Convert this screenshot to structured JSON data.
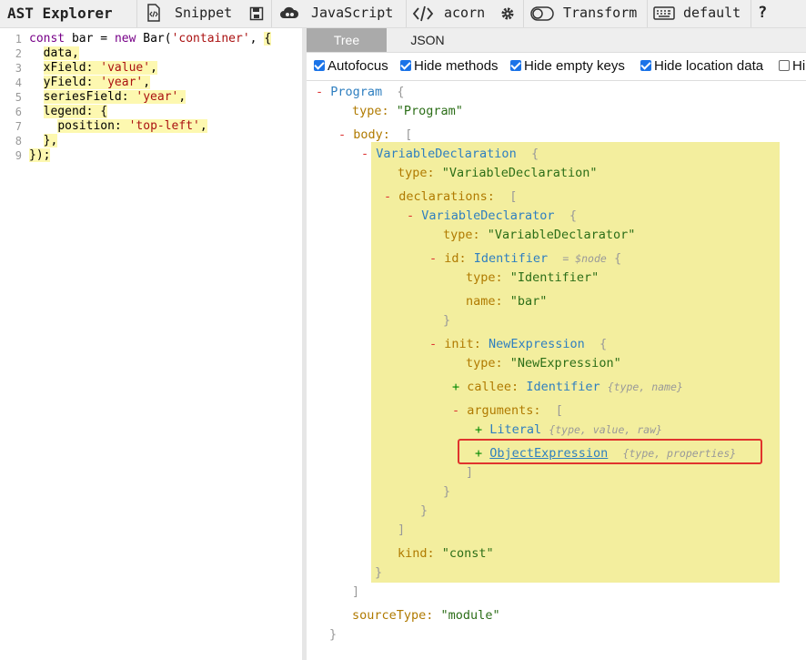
{
  "toolbar": {
    "title": "AST Explorer",
    "snippet_label": "Snippet",
    "language_label": "JavaScript",
    "parser_label": "acorn",
    "transform_label": "Transform",
    "keymap_label": "default",
    "help_label": "?"
  },
  "editor": {
    "lines": [
      {
        "n": "1",
        "text": "const bar = new Bar('container', {"
      },
      {
        "n": "2",
        "text": "  data,"
      },
      {
        "n": "3",
        "text": "  xField: 'value',"
      },
      {
        "n": "4",
        "text": "  yField: 'year',"
      },
      {
        "n": "5",
        "text": "  seriesField: 'year',"
      },
      {
        "n": "6",
        "text": "  legend: {"
      },
      {
        "n": "7",
        "text": "    position: 'top-left',"
      },
      {
        "n": "8",
        "text": "  },"
      },
      {
        "n": "9",
        "text": "});"
      }
    ]
  },
  "tabs": {
    "tree": "Tree",
    "json": "JSON"
  },
  "options": {
    "autofocus": {
      "label": "Autofocus",
      "checked": true
    },
    "hide_methods": {
      "label": "Hide methods",
      "checked": true
    },
    "hide_empty_keys": {
      "label": "Hide empty keys",
      "checked": true
    },
    "hide_location": {
      "label": "Hide location data",
      "checked": true
    },
    "hide_type_keys": {
      "label": "Hi",
      "checked": false
    }
  },
  "tree": {
    "program": "Program",
    "type_key": "type:",
    "program_type": "\"Program\"",
    "body_key": "body:",
    "var_decl": "VariableDeclaration",
    "var_decl_type": "\"VariableDeclaration\"",
    "declarations_key": "declarations:",
    "var_declarator": "VariableDeclarator",
    "var_declarator_type": "\"VariableDeclarator\"",
    "id_key": "id:",
    "identifier": "Identifier",
    "node_ref": "= $node",
    "identifier_type": "\"Identifier\"",
    "name_key": "name:",
    "name_value": "\"bar\"",
    "init_key": "init:",
    "new_expression": "NewExpression",
    "new_expression_type": "\"NewExpression\"",
    "callee_key": "callee:",
    "callee_node": "Identifier",
    "callee_meta": "{type, name}",
    "arguments_key": "arguments:",
    "literal": "Literal",
    "literal_meta": "{type, value, raw}",
    "object_expression": "ObjectExpression",
    "object_expression_meta": "{type, properties}",
    "kind_key": "kind:",
    "kind_value": "\"const\"",
    "source_type_key": "sourceType:",
    "source_type_value": "\"module\""
  }
}
